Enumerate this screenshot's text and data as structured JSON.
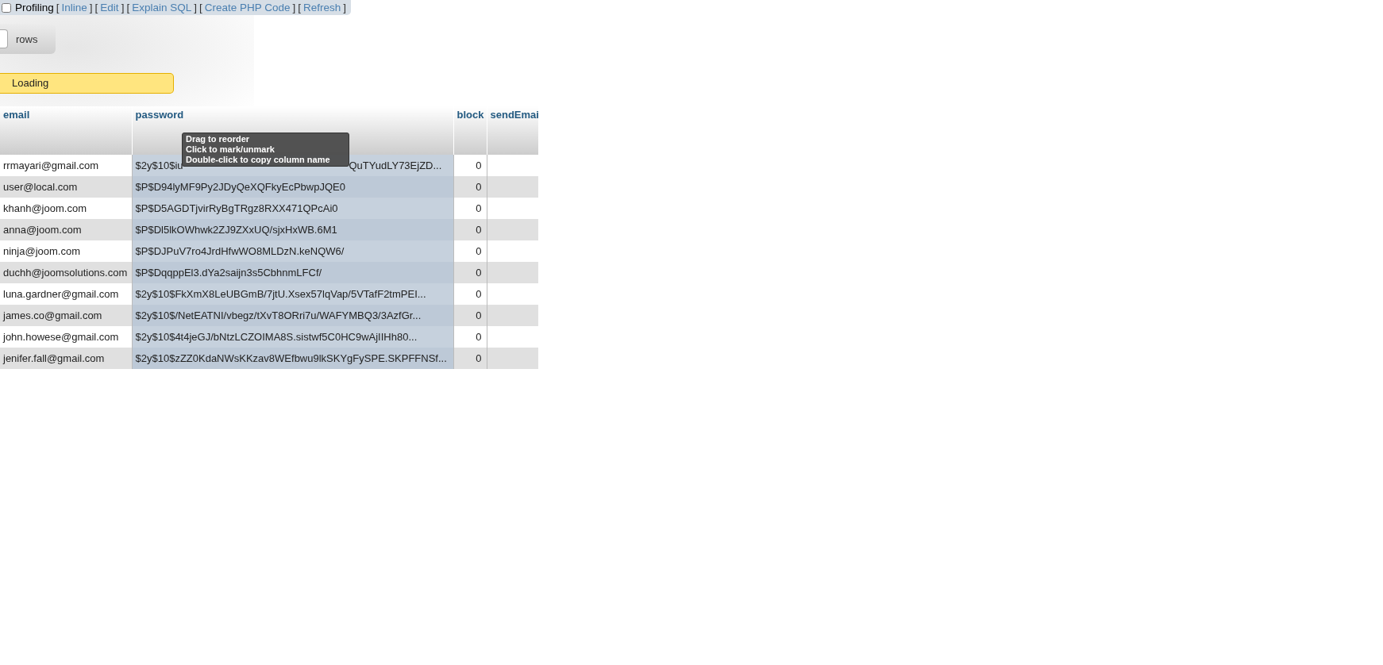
{
  "query_links": {
    "profiling": {
      "label": "Profiling",
      "checked": false
    },
    "links": [
      {
        "open": "[",
        "label": "Inline",
        "close": "]"
      },
      {
        "open": "[",
        "label": "Edit",
        "close": "]"
      },
      {
        "open": "[",
        "label": "Explain SQL",
        "close": "]"
      },
      {
        "open": "[",
        "label": "Create PHP Code",
        "close": "]"
      },
      {
        "open": "[",
        "label": "Refresh",
        "close": "]"
      }
    ]
  },
  "rows_control": {
    "label": "rows"
  },
  "loading": {
    "text": "Loading"
  },
  "table": {
    "columns": [
      {
        "label": "email",
        "marked": false
      },
      {
        "label": "password",
        "marked": true
      },
      {
        "label": "block",
        "marked": false
      },
      {
        "label": "sendEmai",
        "marked": false
      }
    ],
    "rows": [
      {
        "email": "rrmayari@gmail.com",
        "password_start": "$2y$10$iu",
        "password_end": "QuTYudLY73EjZD...",
        "block": "0"
      },
      {
        "email": "user@local.com",
        "password": "$P$D94lyMF9Py2JDyQeXQFkyEcPbwpJQE0",
        "block": "0"
      },
      {
        "email": "khanh@joom.com",
        "password": "$P$D5AGDTjvirRyBgTRgz8RXX471QPcAi0",
        "block": "0"
      },
      {
        "email": "anna@joom.com",
        "password": "$P$Dl5lkOWhwk2ZJ9ZXxUQ/sjxHxWB.6M1",
        "block": "0"
      },
      {
        "email": "ninja@joom.com",
        "password": "$P$DJPuV7ro4JrdHfwWO8MLDzN.keNQW6/",
        "block": "0"
      },
      {
        "email": "duchh@joomsolutions.com",
        "password": "$P$DqqppEl3.dYa2saijn3s5CbhnmLFCf/",
        "block": "0"
      },
      {
        "email": "luna.gardner@gmail.com",
        "password": "$2y$10$FkXmX8LeUBGmB/7jtU.Xsex57lqVap/5VTafF2tmPEI...",
        "block": "0"
      },
      {
        "email": "james.co@gmail.com",
        "password": "$2y$10$/NetEATNI/vbegz/tXvT8ORri7u/WAFYMBQ3/3AzfGr...",
        "block": "0"
      },
      {
        "email": "john.howese@gmail.com",
        "password": "$2y$10$4t4jeGJ/bNtzLCZOIMA8S.sistwf5C0HC9wAjIIHh80...",
        "block": "0"
      },
      {
        "email": "jenifer.fall@gmail.com",
        "password": "$2y$10$zZZ0KdaNWsKKzav8WEfbwu9lkSKYgFySPE.SKPFFNSf...",
        "block": "0"
      }
    ]
  },
  "tooltip": {
    "lines": [
      "Drag to reorder",
      "Click to mark/unmark",
      "Double-click to copy column name"
    ]
  }
}
